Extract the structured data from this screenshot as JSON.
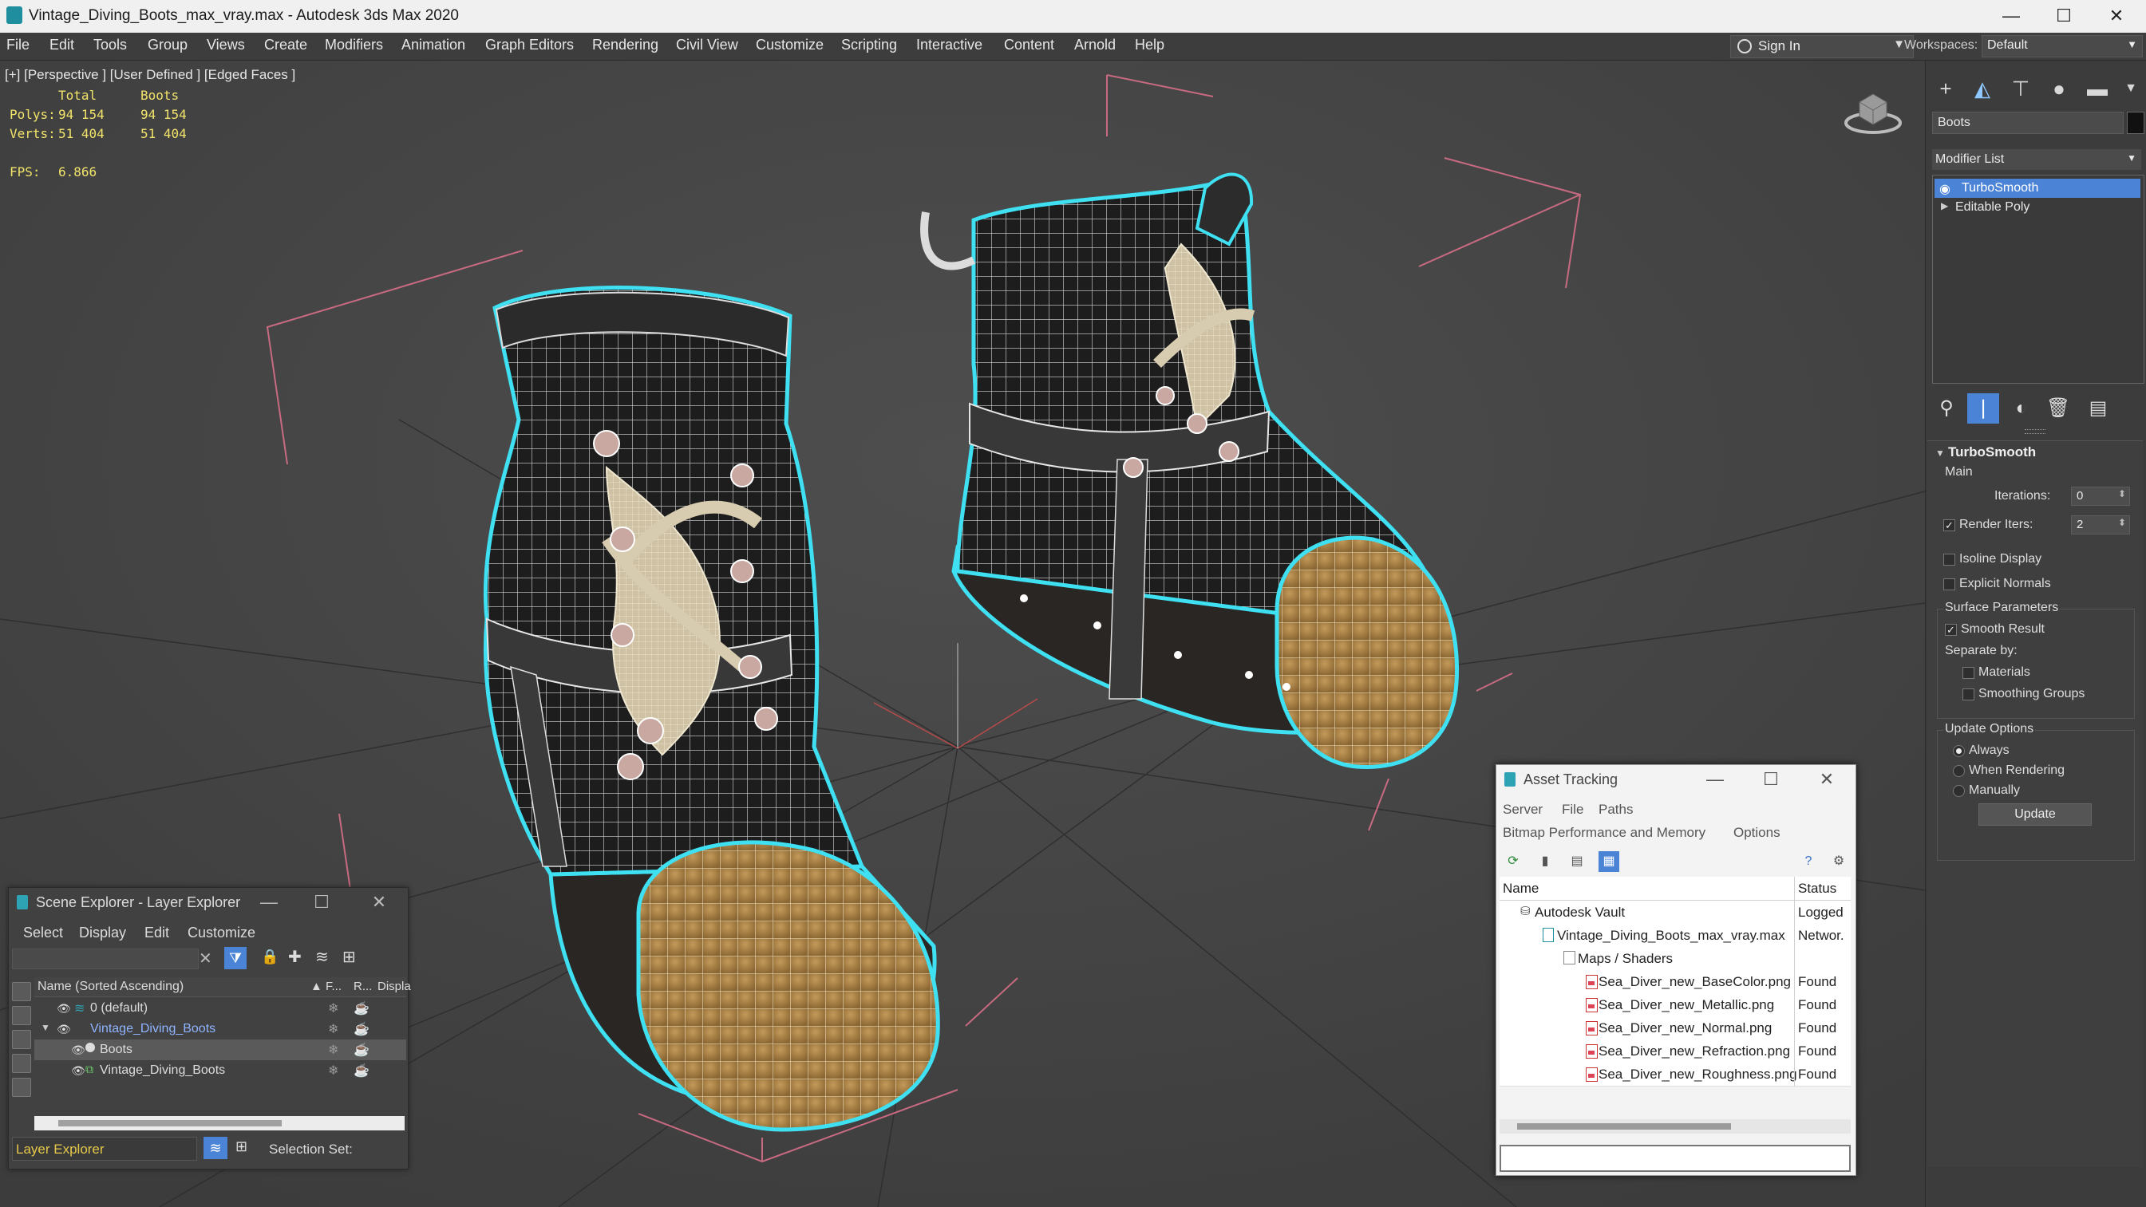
{
  "window": {
    "title": "Vintage_Diving_Boots_max_vray.max - Autodesk 3ds Max 2020",
    "minimize": "—",
    "maximize": "☐",
    "close": "✕"
  },
  "menubar": {
    "items": [
      "File",
      "Edit",
      "Tools",
      "Group",
      "Views",
      "Create",
      "Modifiers",
      "Animation",
      "Graph Editors",
      "Rendering",
      "Civil View",
      "Customize",
      "Scripting",
      "Interactive",
      "Content",
      "Arnold",
      "Help"
    ],
    "signin_label": "Sign In",
    "workspaces_label": "Workspaces:",
    "workspace_value": "Default"
  },
  "viewport": {
    "label": "[+] [Perspective ] [User Defined ] [Edged Faces ]",
    "stats": {
      "col_total": "Total",
      "col_boots": "Boots",
      "polys_label": "Polys:",
      "polys_total": "94 154",
      "polys_boots": "94 154",
      "verts_label": "Verts:",
      "verts_total": "51 404",
      "verts_boots": "51 404",
      "fps_label": "FPS:",
      "fps_value": "6.866"
    }
  },
  "command_panel": {
    "object_name": "Boots",
    "modifier_list_label": "Modifier List",
    "modifier_stack": [
      "TurboSmooth",
      "Editable Poly"
    ],
    "rollup": {
      "title": "TurboSmooth",
      "main_label": "Main",
      "iterations_label": "Iterations:",
      "iterations_value": "0",
      "render_iters_label": "Render Iters:",
      "render_iters_value": "2",
      "render_iters_checked": true,
      "isoline_label": "Isoline Display",
      "isoline_checked": false,
      "explicit_normals_label": "Explicit Normals",
      "explicit_normals_checked": false,
      "surface_params_label": "Surface Parameters",
      "smooth_result_label": "Smooth Result",
      "smooth_result_checked": true,
      "separate_by_label": "Separate by:",
      "materials_label": "Materials",
      "smoothing_groups_label": "Smoothing Groups",
      "update_options_label": "Update Options",
      "always_label": "Always",
      "when_rendering_label": "When Rendering",
      "manually_label": "Manually",
      "selected_update_option": "Always",
      "update_button": "Update"
    }
  },
  "scene_explorer": {
    "title": "Scene Explorer - Layer Explorer",
    "menus": [
      "Select",
      "Display",
      "Edit",
      "Customize"
    ],
    "col_name": "Name (Sorted Ascending)",
    "col_f": "▲ F...",
    "col_r": "R...",
    "col_display": "Displa",
    "rows": [
      {
        "name": "0 (default)",
        "level": 1,
        "selected": false
      },
      {
        "name": "Vintage_Diving_Boots",
        "level": 1,
        "selected": false,
        "highlight": true
      },
      {
        "name": "Boots",
        "level": 2,
        "selected": true
      },
      {
        "name": "Vintage_Diving_Boots",
        "level": 2,
        "selected": false
      }
    ],
    "footer_layer": "Layer Explorer",
    "footer_selection": "Selection Set:"
  },
  "asset_tracking": {
    "title": "Asset Tracking",
    "menus": [
      "Server",
      "File",
      "Paths"
    ],
    "menus2": [
      "Bitmap Performance and Memory",
      "Options"
    ],
    "col_name": "Name",
    "col_status": "Status",
    "rows": [
      {
        "name": "Autodesk Vault",
        "status": "Logged",
        "indent": 1
      },
      {
        "name": "Vintage_Diving_Boots_max_vray.max",
        "status": "Networ.",
        "indent": 2
      },
      {
        "name": "Maps / Shaders",
        "status": "",
        "indent": 3
      },
      {
        "name": "Sea_Diver_new_BaseColor.png",
        "status": "Found",
        "indent": 4
      },
      {
        "name": "Sea_Diver_new_Metallic.png",
        "status": "Found",
        "indent": 4
      },
      {
        "name": "Sea_Diver_new_Normal.png",
        "status": "Found",
        "indent": 4
      },
      {
        "name": "Sea_Diver_new_Refraction.png",
        "status": "Found",
        "indent": 4
      },
      {
        "name": "Sea_Diver_new_Roughness.png",
        "status": "Found",
        "indent": 4
      }
    ]
  },
  "colors": {
    "accent": "#5da0e6",
    "selection": "#4b84d6",
    "wire_highlight": "#3ee0f2",
    "stats_yellow": "#f2e36b",
    "layer_explorer_text": "#e5c84a"
  }
}
